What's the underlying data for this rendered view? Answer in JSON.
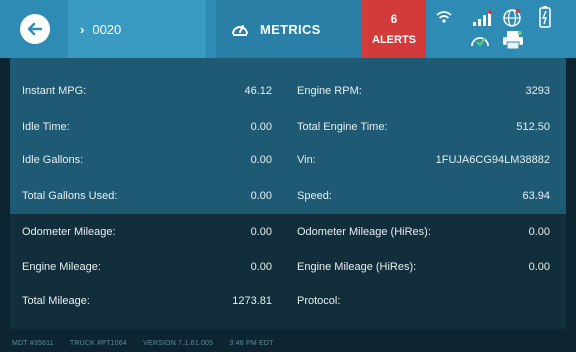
{
  "header": {
    "unit_label": "0020",
    "metrics_label": "METRICS",
    "alerts_count": "6",
    "alerts_label": "ALERTS",
    "status_icons": [
      "wifi-icon",
      "signal-icon",
      "globe-icon",
      "battery-icon",
      "gauge-icon",
      "printer-icon"
    ]
  },
  "metrics": {
    "rows": [
      {
        "label1": "Instant MPG:",
        "value1": "46.12",
        "label2": "Engine RPM:",
        "value2": "3293"
      },
      {
        "label1": "Idle Time:",
        "value1": "0.00",
        "label2": "Total Engine Time:",
        "value2": "512.50"
      },
      {
        "label1": "Idle Gallons:",
        "value1": "0.00",
        "label2": "Vin:",
        "value2": "1FUJA6CG94LM38882"
      },
      {
        "label1": "Total Gallons Used:",
        "value1": "0.00",
        "label2": "Speed:",
        "value2": "63.94"
      },
      {
        "label1": "Odometer Mileage:",
        "value1": "0.00",
        "label2": "Odometer Mileage (HiRes):",
        "value2": "0.00"
      },
      {
        "label1": "Engine Mileage:",
        "value1": "0.00",
        "label2": "Engine Mileage (HiRes):",
        "value2": "0.00"
      },
      {
        "label1": "Total Mileage:",
        "value1": "1273.81",
        "label2": "Protocol:",
        "value2": ""
      }
    ]
  },
  "footer": {
    "mdt": "MDT #35611",
    "truck": "TRUCK #PT1064",
    "version": "VERSION  7.1.61.005",
    "time": "3:46 PM EDT"
  },
  "colors": {
    "topbar": "#2e8bb3",
    "alerts": "#d33a3a",
    "panel_top": "#1e5a73",
    "panel_bottom": "#122e3a"
  }
}
